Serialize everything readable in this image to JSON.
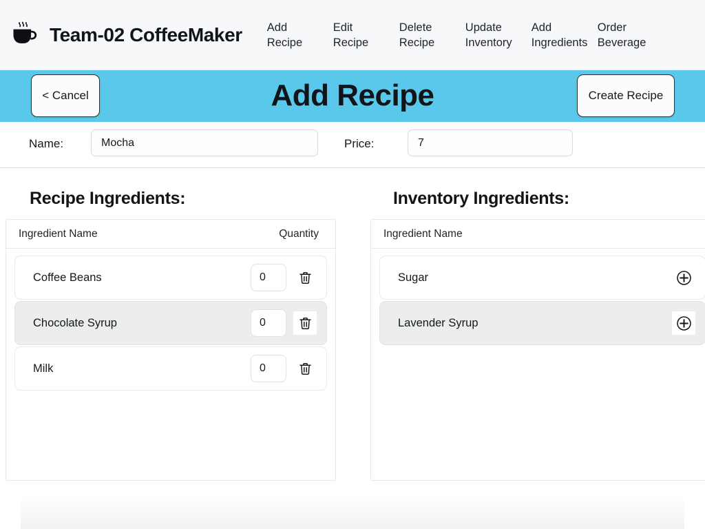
{
  "topnav": {
    "logo_icon": "coffee-cup-icon",
    "brand_title": "Team-02 CoffeeMaker",
    "links": [
      {
        "line1": "Add",
        "line2": "Recipe"
      },
      {
        "line1": "Edit",
        "line2": "Recipe"
      },
      {
        "line1": "Delete",
        "line2": "Recipe"
      },
      {
        "line1": "Update",
        "line2": "Inventory"
      },
      {
        "line1": "Add",
        "line2": "Ingredients"
      },
      {
        "line1": "Order",
        "line2": "Beverage"
      }
    ]
  },
  "header": {
    "background_color": "#5ac8ea",
    "cancel_label": "< Cancel",
    "title": "Add Recipe",
    "create_label": "Create Recipe"
  },
  "form": {
    "name_label": "Name:",
    "name_value": "Mocha",
    "name_placeholder": "",
    "price_label": "Price:",
    "price_value": "7",
    "price_placeholder": ""
  },
  "recipe_panel": {
    "heading": "Recipe Ingredients:",
    "columns": {
      "name": "Ingredient Name",
      "quantity": "Quantity"
    },
    "rows": [
      {
        "name": "Coffee Beans",
        "quantity": "0",
        "selected": false,
        "action_icon": "trash-icon",
        "action_focused": false
      },
      {
        "name": "Chocolate Syrup",
        "quantity": "0",
        "selected": true,
        "action_icon": "trash-icon",
        "action_focused": true
      },
      {
        "name": "Milk",
        "quantity": "0",
        "selected": false,
        "action_icon": "trash-icon",
        "action_focused": false
      }
    ]
  },
  "inventory_panel": {
    "heading": "Inventory Ingredients:",
    "columns": {
      "name": "Ingredient Name"
    },
    "rows": [
      {
        "name": "Sugar",
        "selected": false,
        "action_icon": "plus-circle-icon",
        "action_focused": false
      },
      {
        "name": "Lavender Syrup",
        "selected": true,
        "action_icon": "plus-circle-icon",
        "action_focused": true
      }
    ]
  }
}
